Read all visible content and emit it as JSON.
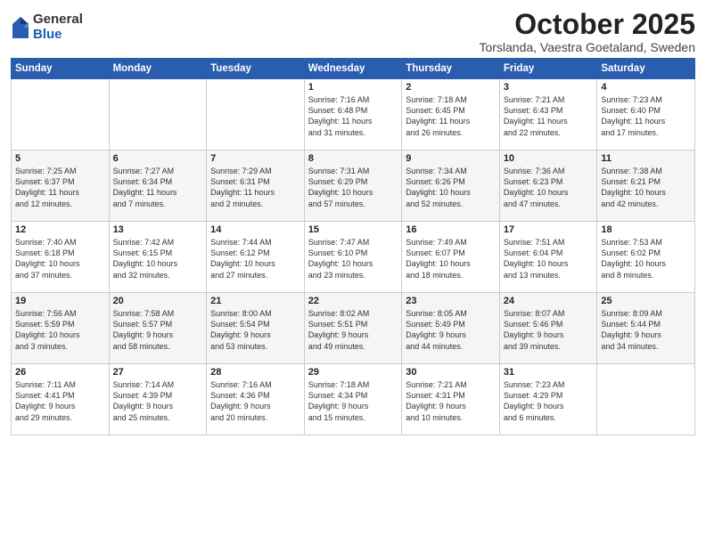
{
  "logo": {
    "general": "General",
    "blue": "Blue"
  },
  "title": "October 2025",
  "location": "Torslanda, Vaestra Goetaland, Sweden",
  "days_of_week": [
    "Sunday",
    "Monday",
    "Tuesday",
    "Wednesday",
    "Thursday",
    "Friday",
    "Saturday"
  ],
  "weeks": [
    [
      {
        "day": "",
        "info": ""
      },
      {
        "day": "",
        "info": ""
      },
      {
        "day": "",
        "info": ""
      },
      {
        "day": "1",
        "info": "Sunrise: 7:16 AM\nSunset: 6:48 PM\nDaylight: 11 hours\nand 31 minutes."
      },
      {
        "day": "2",
        "info": "Sunrise: 7:18 AM\nSunset: 6:45 PM\nDaylight: 11 hours\nand 26 minutes."
      },
      {
        "day": "3",
        "info": "Sunrise: 7:21 AM\nSunset: 6:43 PM\nDaylight: 11 hours\nand 22 minutes."
      },
      {
        "day": "4",
        "info": "Sunrise: 7:23 AM\nSunset: 6:40 PM\nDaylight: 11 hours\nand 17 minutes."
      }
    ],
    [
      {
        "day": "5",
        "info": "Sunrise: 7:25 AM\nSunset: 6:37 PM\nDaylight: 11 hours\nand 12 minutes."
      },
      {
        "day": "6",
        "info": "Sunrise: 7:27 AM\nSunset: 6:34 PM\nDaylight: 11 hours\nand 7 minutes."
      },
      {
        "day": "7",
        "info": "Sunrise: 7:29 AM\nSunset: 6:31 PM\nDaylight: 11 hours\nand 2 minutes."
      },
      {
        "day": "8",
        "info": "Sunrise: 7:31 AM\nSunset: 6:29 PM\nDaylight: 10 hours\nand 57 minutes."
      },
      {
        "day": "9",
        "info": "Sunrise: 7:34 AM\nSunset: 6:26 PM\nDaylight: 10 hours\nand 52 minutes."
      },
      {
        "day": "10",
        "info": "Sunrise: 7:36 AM\nSunset: 6:23 PM\nDaylight: 10 hours\nand 47 minutes."
      },
      {
        "day": "11",
        "info": "Sunrise: 7:38 AM\nSunset: 6:21 PM\nDaylight: 10 hours\nand 42 minutes."
      }
    ],
    [
      {
        "day": "12",
        "info": "Sunrise: 7:40 AM\nSunset: 6:18 PM\nDaylight: 10 hours\nand 37 minutes."
      },
      {
        "day": "13",
        "info": "Sunrise: 7:42 AM\nSunset: 6:15 PM\nDaylight: 10 hours\nand 32 minutes."
      },
      {
        "day": "14",
        "info": "Sunrise: 7:44 AM\nSunset: 6:12 PM\nDaylight: 10 hours\nand 27 minutes."
      },
      {
        "day": "15",
        "info": "Sunrise: 7:47 AM\nSunset: 6:10 PM\nDaylight: 10 hours\nand 23 minutes."
      },
      {
        "day": "16",
        "info": "Sunrise: 7:49 AM\nSunset: 6:07 PM\nDaylight: 10 hours\nand 18 minutes."
      },
      {
        "day": "17",
        "info": "Sunrise: 7:51 AM\nSunset: 6:04 PM\nDaylight: 10 hours\nand 13 minutes."
      },
      {
        "day": "18",
        "info": "Sunrise: 7:53 AM\nSunset: 6:02 PM\nDaylight: 10 hours\nand 8 minutes."
      }
    ],
    [
      {
        "day": "19",
        "info": "Sunrise: 7:56 AM\nSunset: 5:59 PM\nDaylight: 10 hours\nand 3 minutes."
      },
      {
        "day": "20",
        "info": "Sunrise: 7:58 AM\nSunset: 5:57 PM\nDaylight: 9 hours\nand 58 minutes."
      },
      {
        "day": "21",
        "info": "Sunrise: 8:00 AM\nSunset: 5:54 PM\nDaylight: 9 hours\nand 53 minutes."
      },
      {
        "day": "22",
        "info": "Sunrise: 8:02 AM\nSunset: 5:51 PM\nDaylight: 9 hours\nand 49 minutes."
      },
      {
        "day": "23",
        "info": "Sunrise: 8:05 AM\nSunset: 5:49 PM\nDaylight: 9 hours\nand 44 minutes."
      },
      {
        "day": "24",
        "info": "Sunrise: 8:07 AM\nSunset: 5:46 PM\nDaylight: 9 hours\nand 39 minutes."
      },
      {
        "day": "25",
        "info": "Sunrise: 8:09 AM\nSunset: 5:44 PM\nDaylight: 9 hours\nand 34 minutes."
      }
    ],
    [
      {
        "day": "26",
        "info": "Sunrise: 7:11 AM\nSunset: 4:41 PM\nDaylight: 9 hours\nand 29 minutes."
      },
      {
        "day": "27",
        "info": "Sunrise: 7:14 AM\nSunset: 4:39 PM\nDaylight: 9 hours\nand 25 minutes."
      },
      {
        "day": "28",
        "info": "Sunrise: 7:16 AM\nSunset: 4:36 PM\nDaylight: 9 hours\nand 20 minutes."
      },
      {
        "day": "29",
        "info": "Sunrise: 7:18 AM\nSunset: 4:34 PM\nDaylight: 9 hours\nand 15 minutes."
      },
      {
        "day": "30",
        "info": "Sunrise: 7:21 AM\nSunset: 4:31 PM\nDaylight: 9 hours\nand 10 minutes."
      },
      {
        "day": "31",
        "info": "Sunrise: 7:23 AM\nSunset: 4:29 PM\nDaylight: 9 hours\nand 6 minutes."
      },
      {
        "day": "",
        "info": ""
      }
    ]
  ]
}
